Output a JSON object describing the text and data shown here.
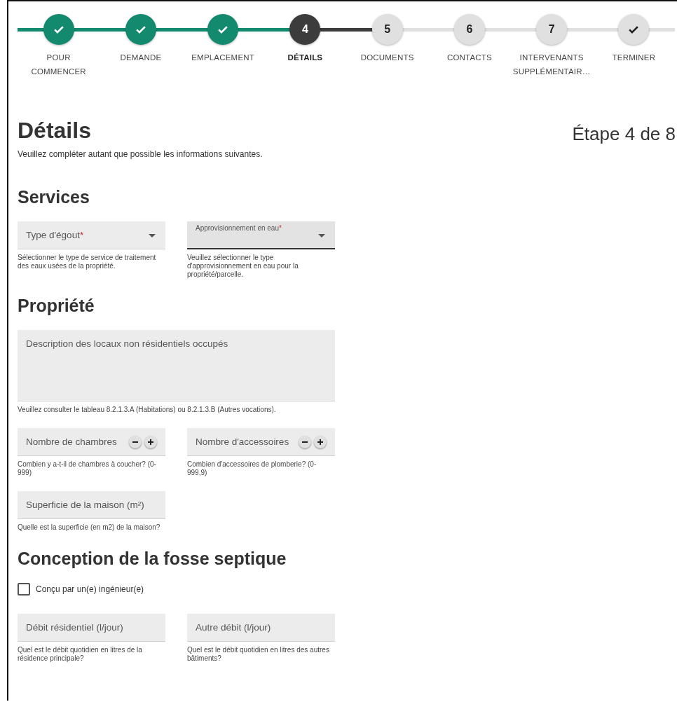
{
  "stepper": [
    {
      "label": "POUR COMMENCER",
      "completed": true,
      "selected": false
    },
    {
      "label": "DEMANDE",
      "completed": true,
      "selected": false
    },
    {
      "label": "EMPLACEMENT",
      "completed": true,
      "selected": false
    },
    {
      "label": "DÉTAILS",
      "completed": false,
      "selected": true,
      "number": "4"
    },
    {
      "label": "DOCUMENTS",
      "completed": false,
      "selected": false,
      "number": "5"
    },
    {
      "label": "CONTACTS",
      "completed": false,
      "selected": false,
      "number": "6"
    },
    {
      "label": "INTERVENANTS SUPPLÉMENTAIR…",
      "completed": false,
      "selected": false,
      "number": "7"
    },
    {
      "label": "TERMINER",
      "completed": false,
      "selected": false
    }
  ],
  "page": {
    "title": "Détails",
    "step_indicator": "Étape 4 de 8",
    "intro": "Veuillez compléter autant que possible les informations suivantes."
  },
  "sections": [
    {
      "title": "Services",
      "rows": [
        [
          {
            "kind": "select",
            "label": "Type d'égout",
            "required_marker": "*",
            "focused": false,
            "help": "Sélectionner le type de service de traitement des eaux usées de la propriété."
          },
          {
            "kind": "select",
            "label": "Approvisionnement en eau",
            "required_marker": "*",
            "focused": true,
            "help": "Veuillez sélectionner le type d'approvisionnement en eau pour la propriété/parcelle."
          }
        ]
      ]
    },
    {
      "title": "Propriété",
      "rows": [
        [
          {
            "kind": "textarea",
            "label": "Description des locaux non résidentiels occupés",
            "focused": false,
            "help": "Veuillez consulter le tableau 8.2.1.3.A (Habitations) ou 8.2.1.3.B (Autres vocations)."
          }
        ],
        [
          {
            "kind": "number",
            "label": "Nombre de chambres",
            "focused": false,
            "help": "Combien y a-t-il de chambres à coucher? (0-999)"
          },
          {
            "kind": "number",
            "label": "Nombre d'accessoires",
            "focused": false,
            "help": "Combien d'accessoires de plomberie? (0-999,9)"
          }
        ],
        [
          {
            "kind": "text",
            "label": "Superficie de la maison (m²)",
            "focused": false,
            "help": "Quelle est la superficie (en m2) de la maison?"
          }
        ]
      ]
    },
    {
      "title": "Conception de la fosse septique",
      "checkbox": {
        "label": "Conçu par un(e) ingénieur(e)",
        "checked": false
      },
      "rows": [
        [
          {
            "kind": "text",
            "label": "Débit résidentiel (l/jour)",
            "focused": false,
            "help": "Quel est le débit quotidien en litres de la résidence principale?"
          },
          {
            "kind": "text",
            "label": "Autre débit (l/jour)",
            "focused": false,
            "help": "Quel est le débit quotidien en litres des autres bâtiments?"
          }
        ]
      ]
    }
  ]
}
